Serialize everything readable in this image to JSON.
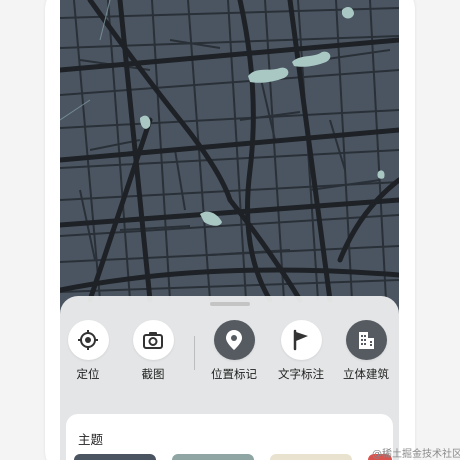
{
  "map": {
    "background_color": "#4b5561",
    "road_color": "#262b31",
    "water_color": "#a9c8c4"
  },
  "panel": {
    "tools": [
      {
        "label": "定位",
        "icon": "locate-icon",
        "style": "light"
      },
      {
        "label": "截图",
        "icon": "camera-icon",
        "style": "light"
      },
      {
        "label": "位置标记",
        "icon": "map-pin-icon",
        "style": "dark"
      },
      {
        "label": "文字标注",
        "icon": "flag-icon",
        "style": "light"
      },
      {
        "label": "立体建筑",
        "icon": "building-icon",
        "style": "dark"
      }
    ],
    "theme": {
      "title": "主题"
    }
  },
  "watermark": {
    "text": "@稀土掘金技术社区"
  }
}
